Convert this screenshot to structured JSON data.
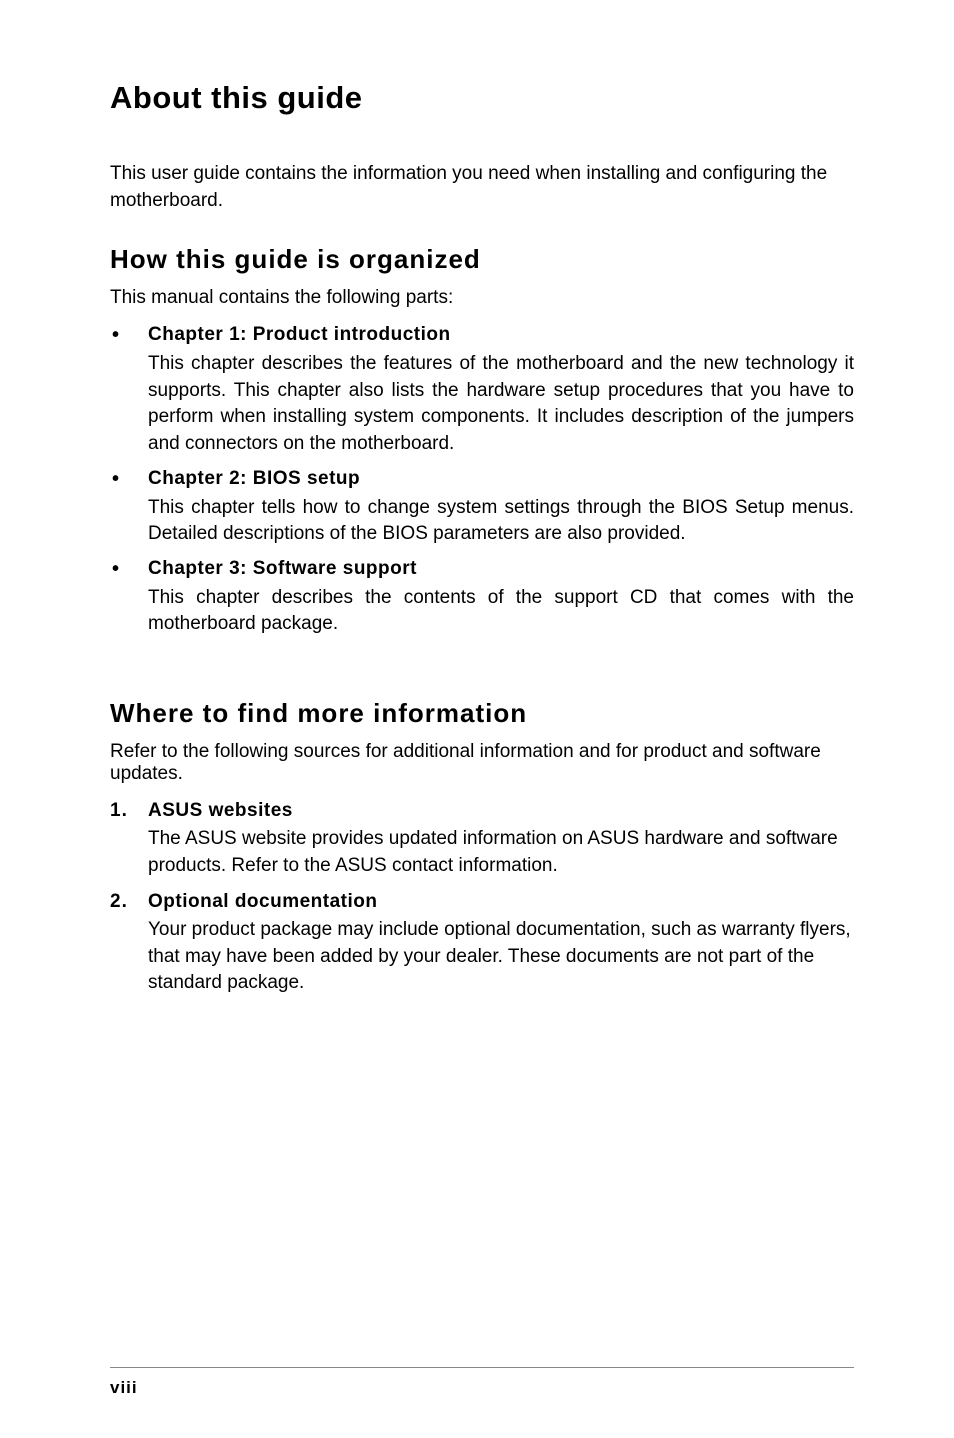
{
  "title": "About this guide",
  "intro": "This user guide contains the information you need when installing and configuring the motherboard.",
  "section1": {
    "heading": "How this guide is organized",
    "intro": "This manual contains the following parts:",
    "items": [
      {
        "title": "Chapter 1: Product introduction",
        "body": "This chapter describes the features of the motherboard and the new technology it supports. This chapter also lists the hardware setup procedures that you have to perform when installing system components. It includes description of the jumpers and connectors on the motherboard."
      },
      {
        "title": "Chapter 2: BIOS setup",
        "body": "This chapter tells how to change system settings through the BIOS Setup menus. Detailed descriptions of the BIOS parameters are also provided."
      },
      {
        "title": "Chapter 3: Software support",
        "body": "This chapter describes the contents of the support CD that comes with the motherboard package."
      }
    ]
  },
  "section2": {
    "heading": "Where to find more information",
    "intro": "Refer to the following sources for additional information and for product and software updates.",
    "items": [
      {
        "number": "1.",
        "title": "ASUS websites",
        "body": "The ASUS website provides updated information on ASUS hardware and software products. Refer to the ASUS contact information."
      },
      {
        "number": "2.",
        "title": "Optional documentation",
        "body": "Your product package may include optional documentation, such as warranty flyers, that may have been added by your dealer. These documents are not part of the standard package."
      }
    ]
  },
  "pageNumber": "viii"
}
